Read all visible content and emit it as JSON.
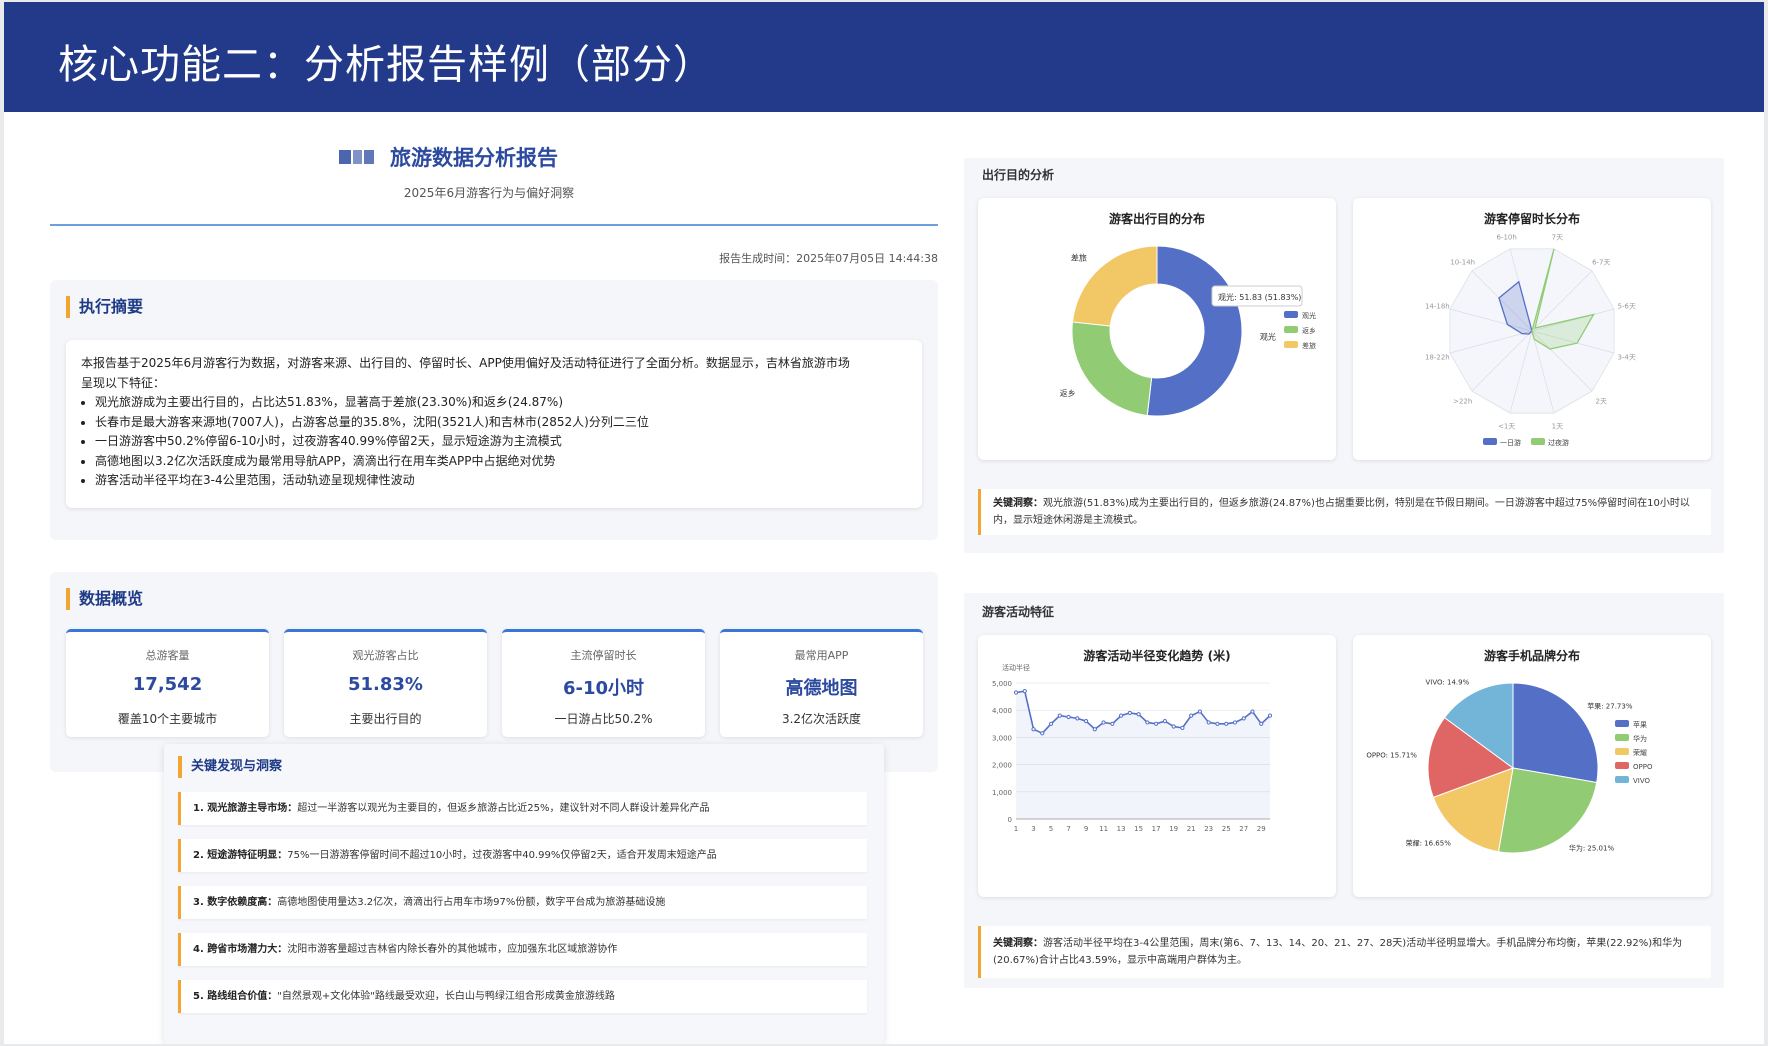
{
  "banner": {
    "title": "核心功能二：分析报告样例（部分）"
  },
  "report": {
    "title": "旅游数据分析报告",
    "subtitle": "2025年6月游客行为与偏好洞察",
    "generated_time": "报告生成时间：2025年07月05日 14:44:38",
    "colors": {
      "accent": "#f3a532",
      "primary": "#2b4aa0",
      "banner": "#233a8b"
    }
  },
  "summary": {
    "heading": "执行摘要",
    "intro_line1": "本报告基于2025年6月游客行为数据，对游客来源、出行目的、停留时长、APP使用偏好及活动特征进行了全面分析。数据显示，吉林省旅游市场",
    "intro_line2": "呈现以下特征：",
    "bullets": [
      "观光旅游成为主要出行目的，占比达51.83%，显著高于差旅(23.30%)和返乡(24.87%)",
      "长春市是最大游客来源地(7007人)，占游客总量的35.8%，沈阳(3521人)和吉林市(2852人)分列二三位",
      "一日游游客中50.2%停留6-10小时，过夜游客40.99%停留2天，显示短途游为主流模式",
      "高德地图以3.2亿次活跃度成为最常用导航APP，滴滴出行在用车类APP中占据绝对优势",
      "游客活动半径平均在3-4公里范围，活动轨迹呈现规律性波动"
    ]
  },
  "overview": {
    "heading": "数据概览",
    "kpis": [
      {
        "label": "总游客量",
        "value": "17,542",
        "sub": "覆盖10个主要城市"
      },
      {
        "label": "观光游客占比",
        "value": "51.83%",
        "sub": "主要出行目的"
      },
      {
        "label": "主流停留时长",
        "value": "6-10小时",
        "sub": "一日游占比50.2%"
      },
      {
        "label": "最常用APP",
        "value": "高德地图",
        "sub": "3.2亿次活跃度"
      }
    ]
  },
  "findings": {
    "heading": "关键发现与洞察",
    "items": [
      {
        "title": "1. 观光旅游主导市场：",
        "text": "超过一半游客以观光为主要目的，但返乡旅游占比近25%，建议针对不同人群设计差异化产品"
      },
      {
        "title": "2. 短途游特征明显：",
        "text": "75%一日游游客停留时间不超过10小时，过夜游客中40.99%仅停留2天，适合开发周末短途产品"
      },
      {
        "title": "3. 数字依赖度高：",
        "text": "高德地图使用量达3.2亿次，滴滴出行占用车市场97%份额，数字平台成为旅游基础设施"
      },
      {
        "title": "4. 跨省市场潜力大：",
        "text": "沈阳市游客量超过吉林省内除长春外的其他城市，应加强东北区域旅游协作"
      },
      {
        "title": "5. 路线组合价值：",
        "text": "\"自然景观+文化体验\"路线最受欢迎，长白山与鸭绿江组合形成黄金旅游线路"
      }
    ]
  },
  "purpose_section": {
    "title": "出行目的分析",
    "note_title": "关键洞察：",
    "note_text": "观光旅游(51.83%)成为主要出行目的，但返乡旅游(24.87%)也占据重要比例，特别是在节假日期间。一日游游客中超过75%停留时间在10小时以内，显示短途休闲游是主流模式。"
  },
  "activity_section": {
    "title": "游客活动特征",
    "note_title": "关键洞察：",
    "note_text": "游客活动半径平均在3-4公里范围，周末(第6、7、13、14、20、21、27、28天)活动半径明显增大。手机品牌分布均衡，苹果(22.92%)和华为(20.67%)合计占比43.59%，显示中高端用户群体为主。"
  },
  "chart_data": [
    {
      "type": "pie",
      "title": "游客出行目的分布",
      "donut": true,
      "categories": [
        "观光",
        "返乡",
        "差旅"
      ],
      "values": [
        51.83,
        24.87,
        23.3
      ],
      "colors": [
        "#5470c6",
        "#91cc75",
        "#f2c867"
      ],
      "legend": "right",
      "tooltip": "观光: 51.83 (51.83%)"
    },
    {
      "type": "radar",
      "title": "游客停留时长分布",
      "axes": [
        "7天",
        "6-7天",
        "5-6天",
        "3-4天",
        "2天",
        "1天",
        "<1天",
        ">22h",
        "18-22h",
        "14-18h",
        "10-14h",
        "6-10h"
      ],
      "series": [
        {
          "name": "一日游",
          "values": [
            0,
            0,
            0,
            0,
            0,
            0,
            0,
            0.05,
            0.12,
            0.3,
            0.55,
            0.6
          ],
          "color": "#5470c6"
        },
        {
          "name": "过夜游",
          "values": [
            1.0,
            0.05,
            0.75,
            0.55,
            0.3,
            0.1,
            0,
            0,
            0,
            0,
            0,
            0
          ],
          "color": "#91cc75"
        }
      ],
      "legend": "bottom"
    },
    {
      "type": "line",
      "title": "游客活动半径变化趋势 (米)",
      "ylabel": "活动半径",
      "ylim": [
        0,
        5000
      ],
      "yticks": [
        "0",
        "1,000",
        "2,000",
        "3,000",
        "4,000",
        "5,000"
      ],
      "xticks": [
        "1",
        "3",
        "5",
        "7",
        "9",
        "11",
        "13",
        "15",
        "17",
        "19",
        "21",
        "23",
        "25",
        "27",
        "29"
      ],
      "x": [
        1,
        2,
        3,
        4,
        5,
        6,
        7,
        8,
        9,
        10,
        11,
        12,
        13,
        14,
        15,
        16,
        17,
        18,
        19,
        20,
        21,
        22,
        23,
        24,
        25,
        26,
        27,
        28,
        29,
        30
      ],
      "values": [
        4650,
        4700,
        3300,
        3150,
        3500,
        3800,
        3750,
        3700,
        3600,
        3300,
        3550,
        3500,
        3800,
        3900,
        3850,
        3550,
        3500,
        3600,
        3400,
        3350,
        3800,
        3950,
        3550,
        3500,
        3500,
        3550,
        3700,
        3950,
        3500,
        3800
      ],
      "color": "#5470c6"
    },
    {
      "type": "pie",
      "title": "游客手机品牌分布",
      "categories": [
        "苹果",
        "华为",
        "荣耀",
        "OPPO",
        "VIVO"
      ],
      "values": [
        27.73,
        25.01,
        16.65,
        15.71,
        14.9
      ],
      "slice_labels": [
        "苹果: 27.73%",
        "华为: 25.01%",
        "荣耀: 16.65%",
        "OPPO: 15.71%",
        "VIVO: 14.9%"
      ],
      "colors": [
        "#5470c6",
        "#91cc75",
        "#f2c867",
        "#e06666",
        "#73b4d9"
      ],
      "legend": "right"
    }
  ]
}
